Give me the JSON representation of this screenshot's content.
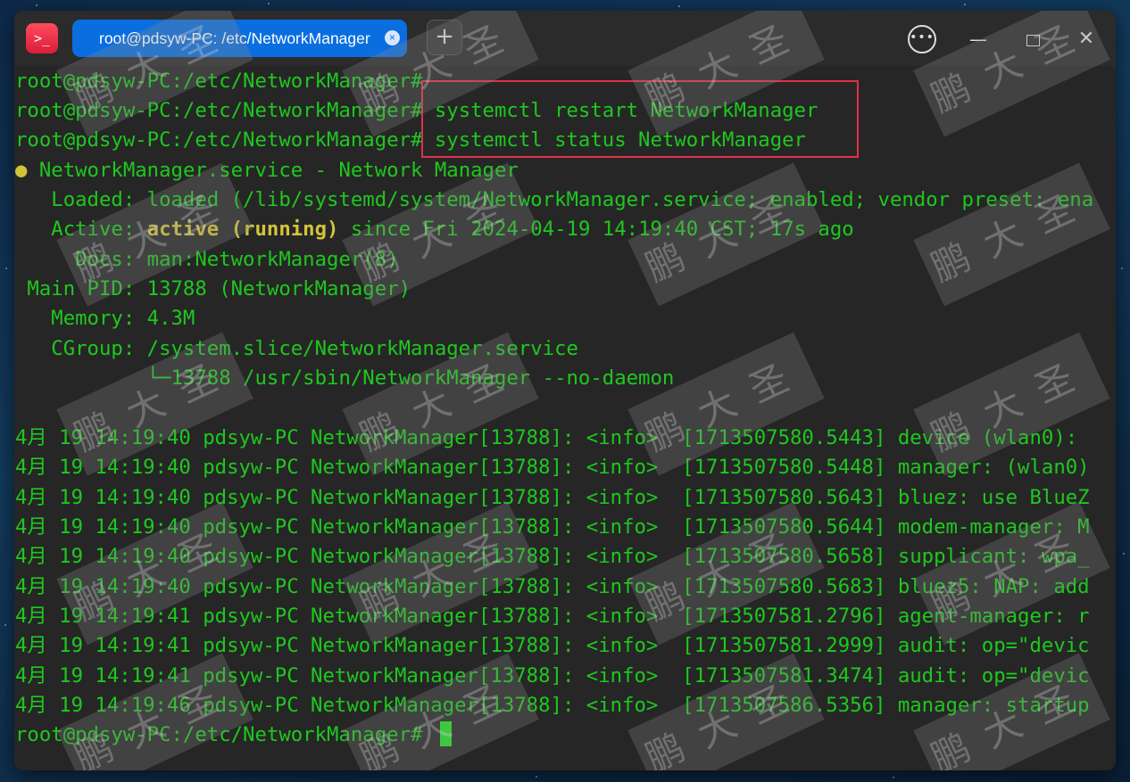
{
  "window": {
    "tab_title": "root@pdsyw-PC: /etc/NetworkManager",
    "tab_close_glyph": "×",
    "new_tab_glyph": "+",
    "menu_glyph": "•••",
    "minimize_glyph": "—",
    "close_glyph": "✕"
  },
  "icons": {
    "app": "terminal-icon",
    "tab_close": "close-icon",
    "new_tab": "plus-icon",
    "menu": "more-icon",
    "minimize": "minimize-icon",
    "maximize": "maximize-icon",
    "close": "close-icon"
  },
  "colors": {
    "terminal_text": "#1ec81e",
    "highlight": "#d2c43a",
    "annotation_box": "#e0304a",
    "tab_active": "#0a6ee0"
  },
  "app_icon_glyph": ">_",
  "watermark": "鹏大圣",
  "terminal": {
    "prompt": "root@pdsyw-PC:/etc/NetworkManager#",
    "commands": [
      "",
      " systemctl restart NetworkManager",
      " systemctl status NetworkManager"
    ],
    "service_line": " NetworkManager.service - Network Manager",
    "service_dot": "●",
    "loaded": "   Loaded: loaded (/lib/systemd/system/NetworkManager.service; enabled; vendor preset: ena",
    "active_prefix": "   Active: ",
    "active_state": "active (running)",
    "active_suffix": " since Fri 2024-04-19 14:19:40 CST; 17s ago",
    "docs": "     Docs: man:NetworkManager(8)",
    "main_pid": " Main PID: 13788 (NetworkManager)",
    "memory": "   Memory: 4.3M",
    "cgroup": "   CGroup: /system.slice/NetworkManager.service",
    "cgroup_child": "           └─13788 /usr/sbin/NetworkManager --no-daemon",
    "logs": [
      "4月 19 14:19:40 pdsyw-PC NetworkManager[13788]: <info>  [1713507580.5443] device (wlan0):",
      "4月 19 14:19:40 pdsyw-PC NetworkManager[13788]: <info>  [1713507580.5448] manager: (wlan0)",
      "4月 19 14:19:40 pdsyw-PC NetworkManager[13788]: <info>  [1713507580.5643] bluez: use BlueZ",
      "4月 19 14:19:40 pdsyw-PC NetworkManager[13788]: <info>  [1713507580.5644] modem-manager: M",
      "4月 19 14:19:40 pdsyw-PC NetworkManager[13788]: <info>  [1713507580.5658] supplicant: wpa_",
      "4月 19 14:19:40 pdsyw-PC NetworkManager[13788]: <info>  [1713507580.5683] bluez5: NAP: add",
      "4月 19 14:19:41 pdsyw-PC NetworkManager[13788]: <info>  [1713507581.2796] agent-manager: r",
      "4月 19 14:19:41 pdsyw-PC NetworkManager[13788]: <info>  [1713507581.2999] audit: op=\"devic",
      "4月 19 14:19:41 pdsyw-PC NetworkManager[13788]: <info>  [1713507581.3474] audit: op=\"devic",
      "4月 19 14:19:46 pdsyw-PC NetworkManager[13788]: <info>  [1713507586.5356] manager: startup"
    ],
    "final_prompt": "root@pdsyw-PC:/etc/NetworkManager# "
  }
}
